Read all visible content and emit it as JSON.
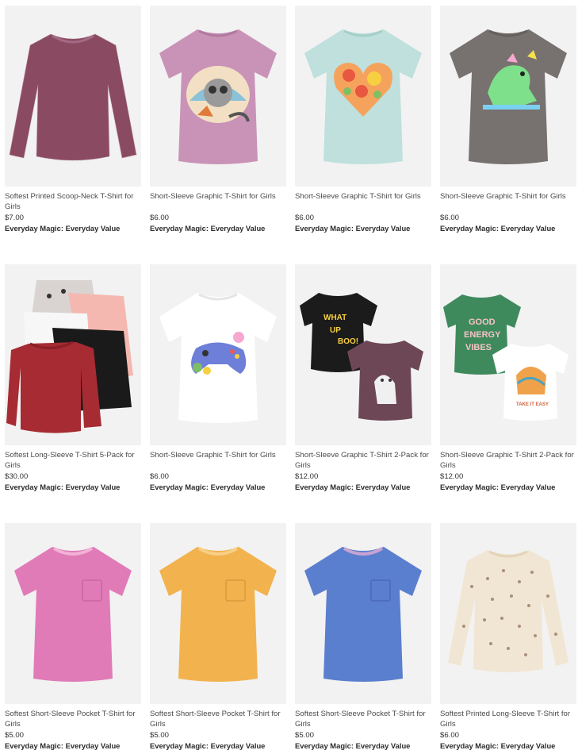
{
  "products": [
    {
      "title": "Softest Printed Scoop-Neck T-Shirt for Girls",
      "price": "$7.00",
      "promo": "Everyday Magic: Everyday Value",
      "image": "burgundy-long-sleeve-tee"
    },
    {
      "title": "Short-Sleeve Graphic T-Shirt for Girls",
      "price": "$6.00",
      "promo": "Everyday Magic: Everyday Value",
      "image": "lilac-raccoon-graphic-tee"
    },
    {
      "title": "Short-Sleeve Graphic T-Shirt for Girls",
      "price": "$6.00",
      "promo": "Everyday Magic: Everyday Value",
      "image": "mint-floral-heart-tee"
    },
    {
      "title": "Short-Sleeve Graphic T-Shirt for Girls",
      "price": "$6.00",
      "promo": "Everyday Magic: Everyday Value",
      "image": "grey-dinosaur-tee"
    },
    {
      "title": "Softest Long-Sleeve T-Shirt 5-Pack for Girls",
      "price": "$30.00",
      "promo": "Everyday Magic: Everyday Value",
      "image": "five-pack-long-sleeve-tees"
    },
    {
      "title": "Short-Sleeve Graphic T-Shirt for Girls",
      "price": "$6.00",
      "promo": "Everyday Magic: Everyday Value",
      "image": "white-game-controller-tee"
    },
    {
      "title": "Short-Sleeve Graphic T-Shirt 2-Pack for Girls",
      "price": "$12.00",
      "promo": "Everyday Magic: Everyday Value",
      "image": "black-and-plum-2-pack"
    },
    {
      "title": "Short-Sleeve Graphic T-Shirt 2-Pack for Girls",
      "price": "$12.00",
      "promo": "Everyday Magic: Everyday Value",
      "image": "green-and-white-2-pack"
    },
    {
      "title": "Softest Short-Sleeve Pocket T-Shirt for Girls",
      "price": "$5.00",
      "promo": "Everyday Magic: Everyday Value",
      "image": "pink-pocket-tee"
    },
    {
      "title": "Softest Short-Sleeve Pocket T-Shirt for Girls",
      "price": "$5.00",
      "promo": "Everyday Magic: Everyday Value",
      "image": "yellow-pocket-tee"
    },
    {
      "title": "Softest Short-Sleeve Pocket T-Shirt for Girls",
      "price": "$5.00",
      "promo": "Everyday Magic: Everyday Value",
      "image": "blue-pocket-tee"
    },
    {
      "title": "Softest Printed Long-Sleeve T-Shirt for Girls",
      "price": "$6.00",
      "promo": "Everyday Magic: Everyday Value",
      "image": "cream-leopard-long-sleeve-tee"
    }
  ],
  "graphics": {
    "what_up_boo": [
      "WHAT",
      "UP",
      "BOO!"
    ],
    "good_energy_vibes": [
      "GOOD",
      "ENERGY",
      "VIBES"
    ],
    "take_it_easy": "TAKE IT EASY"
  },
  "colors": {
    "text_title": "#4a4a4a",
    "text_promo": "#2b2b2b",
    "image_bg": "#f2f2f2",
    "badge": [
      "#e53935",
      "#43a047",
      "#1e88e5",
      "#fdd835"
    ]
  }
}
